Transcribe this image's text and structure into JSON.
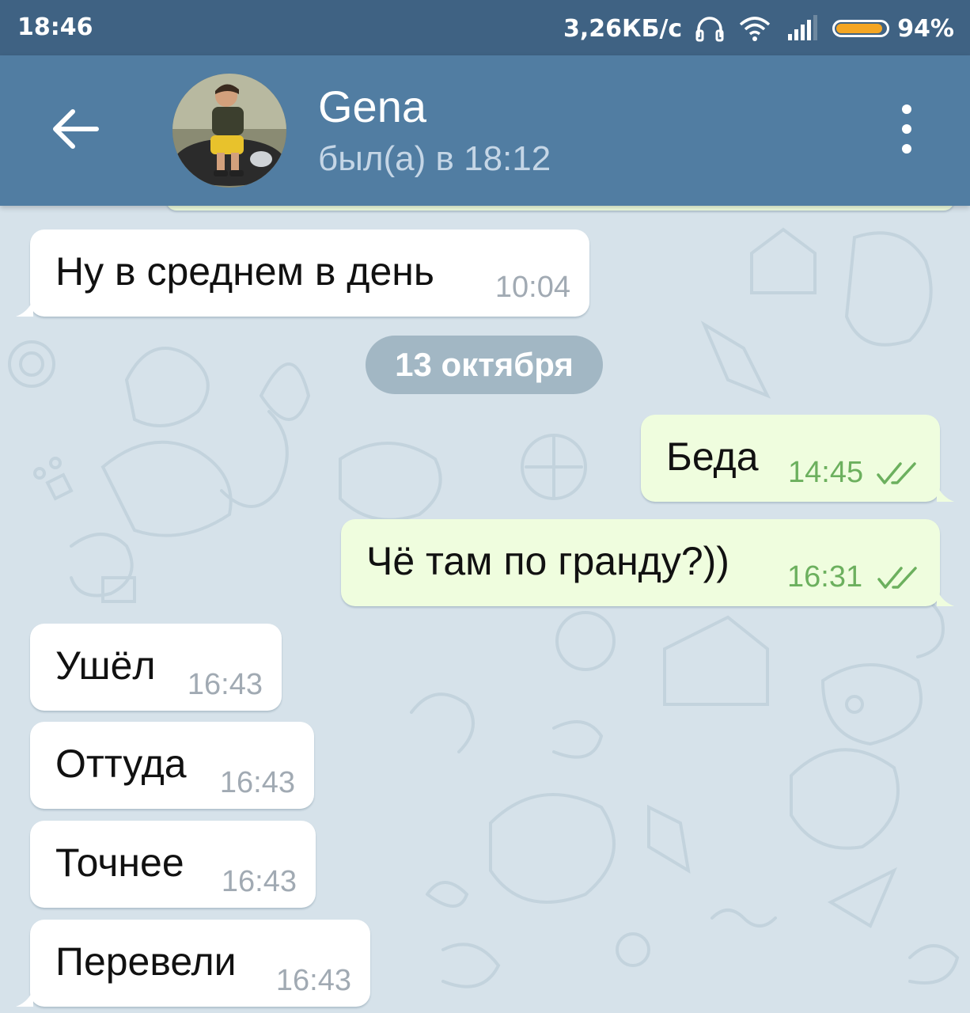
{
  "status_bar": {
    "time": "18:46",
    "speed": "3,26КБ/с",
    "battery": "94%",
    "battery_level": 0.94
  },
  "header": {
    "name": "Gena",
    "last_seen": "был(а) в 18:12"
  },
  "messages": [
    {
      "dir": "in",
      "text": "Ну в среднем в день",
      "time": "10:04"
    },
    {
      "dir": "out",
      "text": "Беда",
      "time": "14:45",
      "read": true
    },
    {
      "dir": "out",
      "text": "Чё там по гранду?))",
      "time": "16:31",
      "read": true
    },
    {
      "dir": "in",
      "text": "Ушёл",
      "time": "16:43"
    },
    {
      "dir": "in",
      "text": "Оттуда",
      "time": "16:43"
    },
    {
      "dir": "in",
      "text": "Точнее",
      "time": "16:43"
    },
    {
      "dir": "in",
      "text": "Перевели",
      "time": "16:43"
    }
  ],
  "date_separator": "13 октября",
  "colors": {
    "header": "#517da2",
    "status_bar": "#3f6283",
    "incoming_bubble": "#ffffff",
    "outgoing_bubble": "#effdde",
    "read_check": "#6cb05e"
  }
}
